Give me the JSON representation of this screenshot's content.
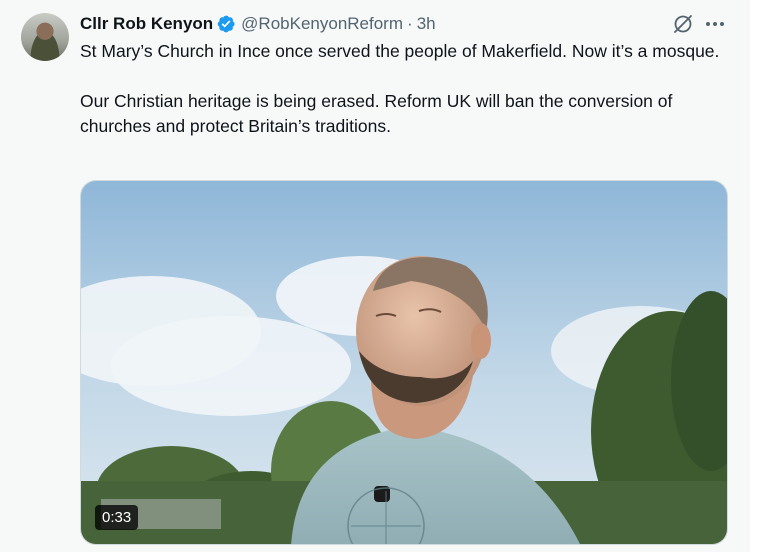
{
  "tweet": {
    "author_name": "Cllr Rob Kenyon",
    "handle": "@RobKenyonReform",
    "separator": "·",
    "time": "3h",
    "paragraphs": [
      "St Mary’s Church in Ince once served the people of Makerfield. Now it’s a mosque.",
      "Our Christian heritage is being erased. Reform UK will ban the conversion of churches and protect Britain’s traditions."
    ],
    "video_duration": "0:33"
  },
  "icons": {
    "verified": "verified-badge-icon",
    "grok": "grok-icon",
    "more": "more-icon"
  },
  "colors": {
    "verified_blue": "#1d9bf0",
    "secondary_text": "#536471",
    "background": "#f7f9f9"
  }
}
